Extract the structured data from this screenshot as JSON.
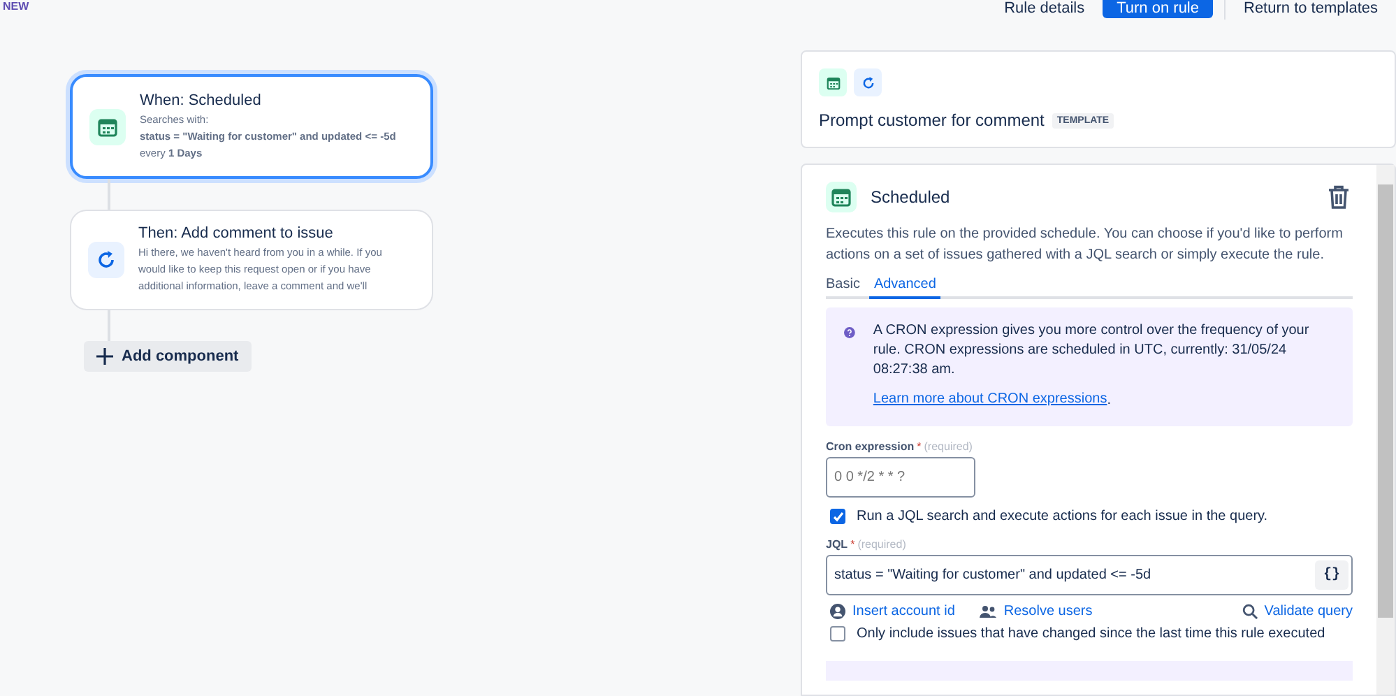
{
  "badge": "NEW",
  "header_buttons": [
    {
      "label": "Rule details",
      "kind": "subtle"
    },
    {
      "label": "Turn on rule",
      "kind": "primary"
    },
    {
      "label": "Return to templates",
      "kind": "subtle"
    }
  ],
  "flow": [
    {
      "kind": "trigger",
      "selected": true,
      "title": "When: Scheduled",
      "lines": [
        "Searches with:",
        "**status = \"Waiting for customer\" and updated <= -5d**",
        "every **1 Days**"
      ]
    },
    {
      "kind": "action",
      "selected": false,
      "title": "Then: Add comment to issue",
      "lines": [
        "Hi there, we haven't heard from you in a while. If you",
        "would like to keep this request open or if you have",
        "additional information, leave a comment and we'll"
      ]
    }
  ],
  "add_component": "Add component",
  "rule": {
    "title": "Prompt customer for comment",
    "tag": "TEMPLATE"
  },
  "panel": {
    "title": "Scheduled",
    "description": "Executes this rule on the provided schedule. You can choose if you'd like to perform actions on a set of issues gathered with a JQL search or simply execute the rule.",
    "tabs": [
      {
        "label": "Basic",
        "selected": false
      },
      {
        "label": "Advanced",
        "selected": true
      }
    ],
    "info": {
      "text": "A CRON expression gives you more control over the frequency of your rule. CRON expressions are scheduled in UTC, currently: 31/05/24 08:27:38 am.",
      "link": "Learn more about CRON expressions",
      "after_link": "."
    },
    "cron": {
      "label": "Cron expression",
      "mark": "*",
      "required": "(required)",
      "placeholder": "0 0 */2 * * ?"
    },
    "run_jql": {
      "label": "Run a JQL search and execute actions for each issue in the query.",
      "checked": true
    },
    "jql": {
      "label": "JQL",
      "mark": "*",
      "required": "(required)",
      "value": "status = \"Waiting for customer\" and updated <= -5d",
      "button": "{}"
    },
    "links": [
      {
        "kind": "person",
        "label": "Insert account id"
      },
      {
        "kind": "people",
        "label": "Resolve users"
      },
      {
        "kind": "search",
        "label": "Validate query"
      }
    ],
    "only_changed": {
      "label": "Only include issues that have changed since the last time this rule executed",
      "checked": false
    }
  }
}
